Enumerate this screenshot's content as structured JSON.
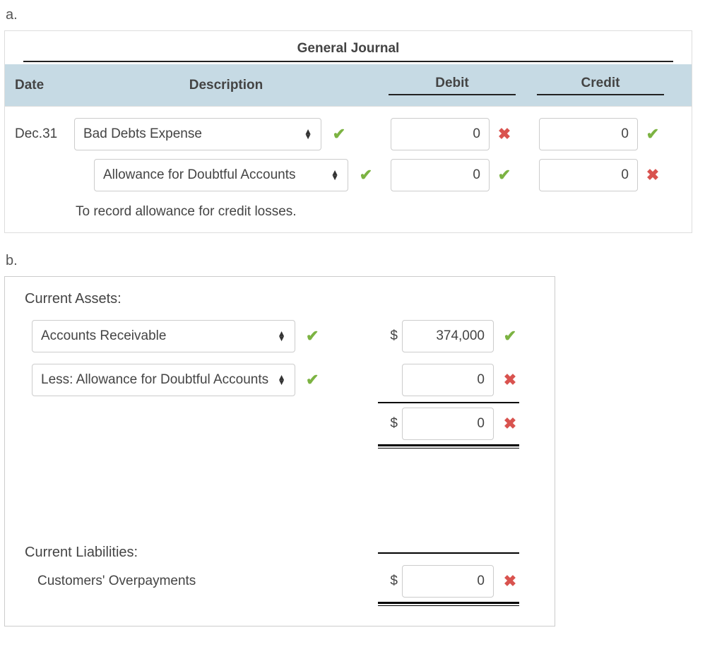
{
  "section_a": {
    "label": "a.",
    "journal_title": "General Journal",
    "headers": {
      "date": "Date",
      "description": "Description",
      "debit": "Debit",
      "credit": "Credit"
    },
    "rows": [
      {
        "date": "Dec.31",
        "account": "Bad Debts Expense",
        "account_mark": "check",
        "debit": "0",
        "debit_mark": "cross",
        "credit": "0",
        "credit_mark": "check",
        "indent": false
      },
      {
        "date": "",
        "account": "Allowance for Doubtful Accounts",
        "account_mark": "check",
        "debit": "0",
        "debit_mark": "check",
        "credit": "0",
        "credit_mark": "cross",
        "indent": true
      }
    ],
    "note": "To record allowance for credit losses."
  },
  "section_b": {
    "label": "b.",
    "current_assets_heading": "Current Assets:",
    "assets_rows": [
      {
        "account": "Accounts Receivable",
        "account_mark": "check",
        "show_dollar": true,
        "value": "374,000",
        "value_mark": "check"
      },
      {
        "account": "Less: Allowance for Doubtful Accounts",
        "account_mark": "check",
        "show_dollar": false,
        "value": "0",
        "value_mark": "cross"
      }
    ],
    "assets_total": {
      "show_dollar": true,
      "value": "0",
      "value_mark": "cross"
    },
    "current_liabilities_heading": "Current Liabilities:",
    "liabilities_row": {
      "label": "Customers' Overpayments",
      "show_dollar": true,
      "value": "0",
      "value_mark": "cross"
    }
  }
}
